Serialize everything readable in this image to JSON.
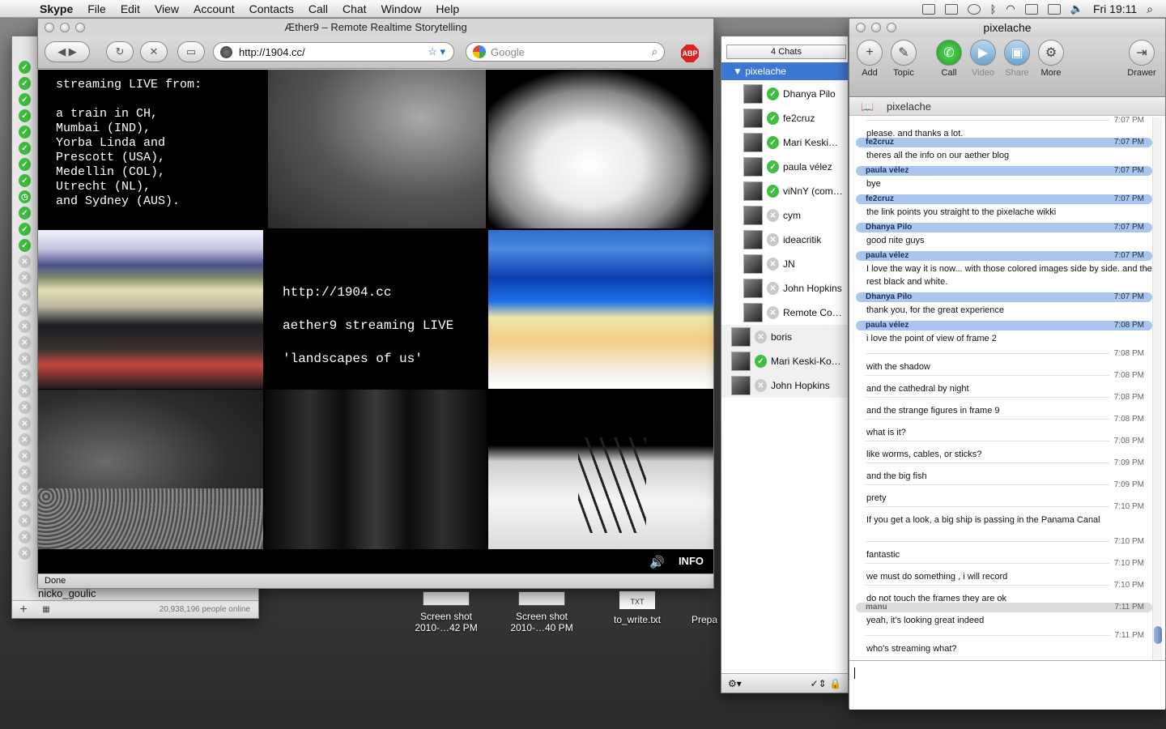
{
  "menubar": {
    "app": "Skype",
    "items": [
      "File",
      "Edit",
      "View",
      "Account",
      "Contacts",
      "Call",
      "Chat",
      "Window",
      "Help"
    ],
    "clock": "Fri 19:11"
  },
  "contact_list": {
    "visible_name": "nicko_goulic",
    "online_count": "20,938,196 people online"
  },
  "browser": {
    "title": "Æther9 – Remote Realtime Storytelling",
    "url": "http://1904.cc/",
    "search_placeholder": "Google",
    "abp": "ABP",
    "status": "Done",
    "stream_text": "streaming LIVE from:\n\na train in CH,\nMumbai (IND),\nYorba Linda and\nPrescott (USA),\nMedellin (COL),\nUtrecht (NL),\nand Sydney (AUS).",
    "center_lines": [
      "http://1904.cc",
      "aether9 streaming LIVE",
      "'landscapes of us'"
    ],
    "info_label": "INFO"
  },
  "desktop_icons": [
    {
      "label": "Screen shot 2010-…42 PM"
    },
    {
      "label": "Screen shot 2010-…40 PM"
    },
    {
      "label": "to_write.txt",
      "badge": "TXT"
    },
    {
      "label": "Prepa"
    }
  ],
  "chats_panel": {
    "header": "4 Chats",
    "selected": "pixelache",
    "members": [
      "Dhanya Pilo",
      "fe2cruz",
      "Mari Keski…",
      "paula vélez",
      "viNnY (com…",
      "cym",
      "ideacritik",
      "JN",
      "John Hopkins",
      "Remote Co…"
    ],
    "others": [
      "boris",
      "Mari Keski-Ko…",
      "John Hopkins"
    ]
  },
  "skype_chat": {
    "title": "pixelache",
    "toolbar": [
      "Add",
      "Topic",
      "Call",
      "Video",
      "Share",
      "More",
      "Drawer"
    ],
    "chat_header": "pixelache",
    "messages": [
      {
        "author": "",
        "time": "7:07 PM",
        "text": "please. and thanks a lot.",
        "style": "plain"
      },
      {
        "author": "fe2cruz",
        "time": "7:07 PM",
        "text": "theres all the info on our aether blog",
        "style": "blue"
      },
      {
        "author": "paula vélez",
        "time": "7:07 PM",
        "text": "bye",
        "style": "blue"
      },
      {
        "author": "fe2cruz",
        "time": "7:07 PM",
        "text": "the link points you straight to the pixelache wikki",
        "style": "blue"
      },
      {
        "author": "Dhanya Pilo",
        "time": "7:07 PM",
        "text": "good nite guys",
        "style": "blue"
      },
      {
        "author": "paula vélez",
        "time": "7:07 PM",
        "text": "I love the way it is now... with those colored images side by side. and the rest black and white.",
        "style": "blue"
      },
      {
        "author": "Dhanya Pilo",
        "time": "7:07 PM",
        "text": "thank you, for the great experience",
        "style": "blue"
      },
      {
        "author": "paula vélez",
        "time": "7:08 PM",
        "text": "i love the point of view of frame 2",
        "style": "blue"
      },
      {
        "author": "",
        "time": "7:08 PM",
        "text": "with the shadow",
        "style": "plain"
      },
      {
        "author": "",
        "time": "7:08 PM",
        "text": "and the cathedral by night",
        "style": "plain"
      },
      {
        "author": "",
        "time": "7:08 PM",
        "text": "and the strange figures in frame 9",
        "style": "plain"
      },
      {
        "author": "",
        "time": "7:08 PM",
        "text": "what is it?",
        "style": "plain"
      },
      {
        "author": "",
        "time": "7:08 PM",
        "text": "like worms, cables, or sticks?",
        "style": "plain"
      },
      {
        "author": "",
        "time": "7:09 PM",
        "text": "and the big fish",
        "style": "plain"
      },
      {
        "author": "",
        "time": "7:09 PM",
        "text": "prety",
        "style": "plain"
      },
      {
        "author": "",
        "time": "7:10 PM",
        "text": "If you get a look, a big ship is passing in the Panama Canal",
        "style": "plain"
      },
      {
        "author": "",
        "time": "7:10 PM",
        "text": "fantastic",
        "style": "plain"
      },
      {
        "author": "",
        "time": "7:10 PM",
        "text": "we must do something , i will record",
        "style": "plain"
      },
      {
        "author": "",
        "time": "7:10 PM",
        "text": "do not touch the frames they are ok",
        "style": "plain"
      },
      {
        "author": "manu",
        "time": "7:11 PM",
        "text": "yeah, it's looking great indeed",
        "style": "gray"
      },
      {
        "author": "",
        "time": "7:11 PM",
        "text": "who's streaming what?",
        "style": "plain"
      }
    ]
  }
}
